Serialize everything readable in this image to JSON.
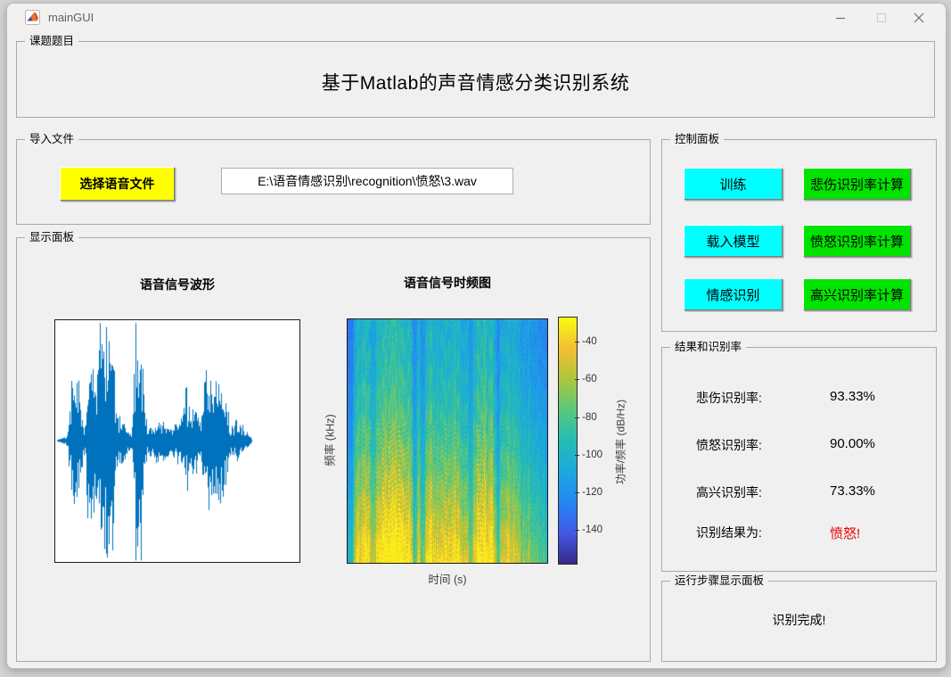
{
  "window": {
    "title": "mainGUI"
  },
  "panels": {
    "topic": {
      "label": "课题题目",
      "title": "基于Matlab的声音情感分类识别系统"
    },
    "import": {
      "label": "导入文件",
      "select_button": "选择语音文件",
      "file_path": "E:\\语音情感识别\\recognition\\愤怒\\3.wav"
    },
    "display": {
      "label": "显示面板",
      "waveform_title": "语音信号波形",
      "spectrogram_title": "语音信号时频图",
      "freq_axis_label": "频率 (kHz)",
      "time_axis_label": "时间 (s)",
      "colorbar_label": "功率/频率 (dB/Hz)"
    },
    "control": {
      "label": "控制面板",
      "buttons": [
        {
          "label": "训练",
          "color": "#00ffff"
        },
        {
          "label": "悲伤识别率计算",
          "color": "#00e400"
        },
        {
          "label": "载入模型",
          "color": "#00ffff"
        },
        {
          "label": "愤怒识别率计算",
          "color": "#00e400"
        },
        {
          "label": "情感识别",
          "color": "#00ffff"
        },
        {
          "label": "高兴识别率计算",
          "color": "#00e400"
        }
      ]
    },
    "results": {
      "label": "结果和识别率",
      "rows": [
        {
          "label": "悲伤识别率:",
          "value": "93.33%",
          "color": "#000000"
        },
        {
          "label": "愤怒识别率:",
          "value": "90.00%",
          "color": "#000000"
        },
        {
          "label": "高兴识别率:",
          "value": "73.33%",
          "color": "#000000"
        },
        {
          "label": "识别结果为:",
          "value": "愤怒!",
          "color": "#ee0000"
        }
      ]
    },
    "steps": {
      "label": "运行步骤显示面板",
      "status": "识别完成!"
    }
  },
  "chart_data": [
    {
      "type": "line",
      "name": "speech-waveform",
      "title": "语音信号波形",
      "line_color": "#0072bd",
      "axes": "no tick labels visible, white background, black box",
      "envelope": [
        [
          0,
          0
        ],
        [
          0.028,
          0.02
        ],
        [
          0.05,
          0.05
        ],
        [
          0.065,
          0.42
        ],
        [
          0.08,
          0.58
        ],
        [
          0.1,
          0.35
        ],
        [
          0.12,
          0.1
        ],
        [
          0.135,
          0.8
        ],
        [
          0.15,
          0.88
        ],
        [
          0.165,
          0.45
        ],
        [
          0.185,
          0.92
        ],
        [
          0.205,
          1.0
        ],
        [
          0.23,
          0.97
        ],
        [
          0.245,
          0.4
        ],
        [
          0.255,
          0.17
        ],
        [
          0.275,
          0.2
        ],
        [
          0.295,
          0.1
        ],
        [
          0.31,
          0.06
        ],
        [
          0.318,
          0.3
        ],
        [
          0.33,
          0.88
        ],
        [
          0.345,
          0.97
        ],
        [
          0.36,
          0.55
        ],
        [
          0.375,
          0.12
        ],
        [
          0.4,
          0.1
        ],
        [
          0.415,
          0.2
        ],
        [
          0.43,
          0.14
        ],
        [
          0.445,
          0.22
        ],
        [
          0.46,
          0.13
        ],
        [
          0.475,
          0.09
        ],
        [
          0.49,
          0.18
        ],
        [
          0.505,
          0.13
        ],
        [
          0.52,
          0.22
        ],
        [
          0.535,
          0.38
        ],
        [
          0.55,
          0.2
        ],
        [
          0.565,
          0.3
        ],
        [
          0.58,
          0.22
        ],
        [
          0.595,
          0.14
        ],
        [
          0.61,
          0.48
        ],
        [
          0.63,
          0.52
        ],
        [
          0.655,
          0.55
        ],
        [
          0.68,
          0.5
        ],
        [
          0.7,
          0.35
        ],
        [
          0.715,
          0.12
        ],
        [
          0.73,
          0.13
        ],
        [
          0.75,
          0.15
        ],
        [
          0.77,
          0.1
        ],
        [
          0.8,
          0.03
        ],
        [
          0.805,
          0
        ]
      ]
    },
    {
      "type": "heatmap",
      "name": "speech-spectrogram",
      "title": "语音信号时频图",
      "xlabel": "时间 (s)",
      "ylabel": "频率 (kHz)",
      "colorbar_label": "功率/频率 (dB/Hz)",
      "colorbar_ticks": [
        "-40",
        "-60",
        "-80",
        "-100",
        "-120",
        "-140"
      ],
      "colormap": "parula",
      "parula_stops": [
        [
          53,
          42,
          135
        ],
        [
          66,
          88,
          230
        ],
        [
          36,
          135,
          243
        ],
        [
          27,
          169,
          222
        ],
        [
          37,
          188,
          180
        ],
        [
          89,
          200,
          125
        ],
        [
          172,
          199,
          57
        ],
        [
          245,
          191,
          50
        ],
        [
          249,
          251,
          20
        ]
      ],
      "column_energy": [
        [
          0,
          0.3
        ],
        [
          0.02,
          0.28
        ],
        [
          0.035,
          0.52
        ],
        [
          0.06,
          0.6
        ],
        [
          0.1,
          0.62
        ],
        [
          0.125,
          0.46
        ],
        [
          0.145,
          0.62
        ],
        [
          0.18,
          0.68
        ],
        [
          0.22,
          0.7
        ],
        [
          0.27,
          0.67
        ],
        [
          0.315,
          0.6
        ],
        [
          0.335,
          0.34
        ],
        [
          0.355,
          0.55
        ],
        [
          0.372,
          0.34
        ],
        [
          0.39,
          0.58
        ],
        [
          0.42,
          0.62
        ],
        [
          0.45,
          0.54
        ],
        [
          0.5,
          0.6
        ],
        [
          0.55,
          0.62
        ],
        [
          0.6,
          0.5
        ],
        [
          0.615,
          0.38
        ],
        [
          0.635,
          0.62
        ],
        [
          0.68,
          0.68
        ],
        [
          0.72,
          0.64
        ],
        [
          0.75,
          0.38
        ],
        [
          0.77,
          0.54
        ],
        [
          0.82,
          0.55
        ],
        [
          0.87,
          0.46
        ],
        [
          0.92,
          0.42
        ],
        [
          1,
          0.36
        ]
      ]
    }
  ]
}
